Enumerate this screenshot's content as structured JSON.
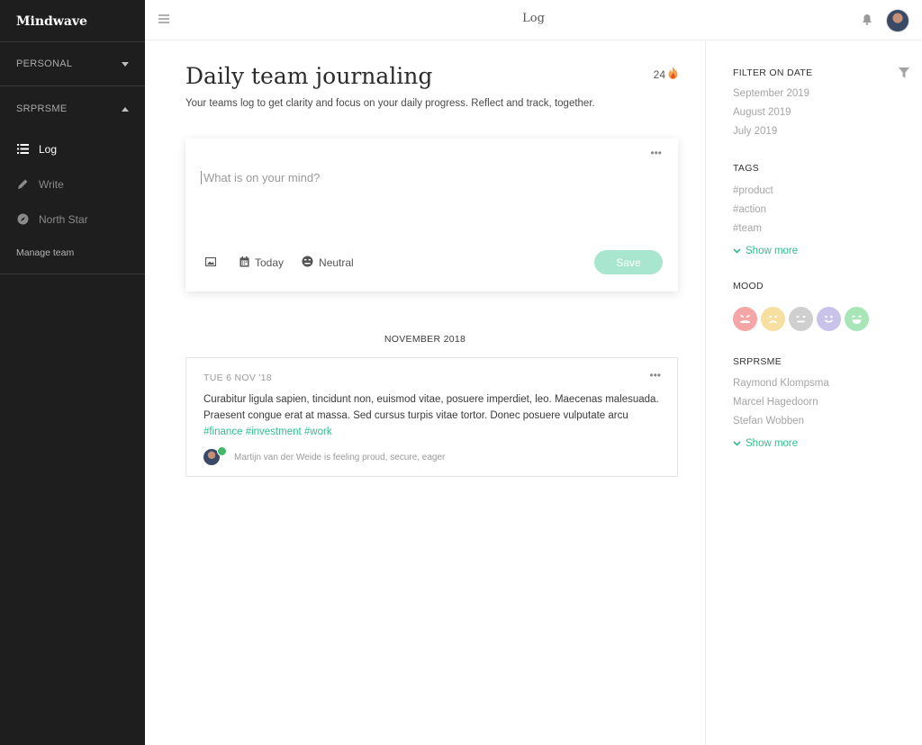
{
  "app": {
    "name": "Mindwave"
  },
  "sidebar": {
    "personal_label": "PERSONAL",
    "team_label": "SRPRSME",
    "items": [
      {
        "label": "Log",
        "icon": "list-icon",
        "active": true
      },
      {
        "label": "Write",
        "icon": "pencil-icon",
        "active": false
      },
      {
        "label": "North Star",
        "icon": "compass-icon",
        "active": false
      }
    ],
    "manage_label": "Manage team"
  },
  "topbar": {
    "title": "Log"
  },
  "main": {
    "title": "Daily team journaling",
    "streak_count": "24",
    "subtitle": "Your teams log to get clarity and focus on your daily progress. Reflect and track, together.",
    "composer": {
      "placeholder": "What is on your mind?",
      "date_label": "Today",
      "mood_label": "Neutral",
      "save_label": "Save"
    },
    "month_label": "NOVEMBER 2018",
    "entry": {
      "date": "TUE 6 NOV '18",
      "text": "Curabitur ligula sapien, tincidunt non, euismod vitae, posuere imperdiet, leo. Maecenas malesuada. Praesent congue erat at massa. Sed cursus turpis vitae tortor. Donec posuere vulputate arcu",
      "tags": [
        "#finance",
        "#investment",
        "#work"
      ],
      "footer": "Martijn van der Weide is feeling proud, secure, eager"
    }
  },
  "right": {
    "filter_title": "FILTER ON DATE",
    "dates": [
      "September 2019",
      "August 2019",
      "July 2019"
    ],
    "tags_title": "TAGS",
    "tags": [
      "#product",
      "#action",
      "#team"
    ],
    "show_more": "Show more",
    "mood_title": "MOOD",
    "moods": [
      {
        "name": "angry",
        "color": "#f4a6a6"
      },
      {
        "name": "sad",
        "color": "#f7dfa0"
      },
      {
        "name": "neutral",
        "color": "#cfcfcf"
      },
      {
        "name": "happy",
        "color": "#c9c2ea"
      },
      {
        "name": "very-happy",
        "color": "#a8e6b8"
      }
    ],
    "team_title": "SRPRSME",
    "members": [
      "Raymond Klompsma",
      "Marcel Hagedoorn",
      "Stefan Wobben"
    ]
  },
  "colors": {
    "accent": "#2fbf8c",
    "save_button": "#a8e6cf",
    "sidebar_bg": "#1e1e1e"
  }
}
